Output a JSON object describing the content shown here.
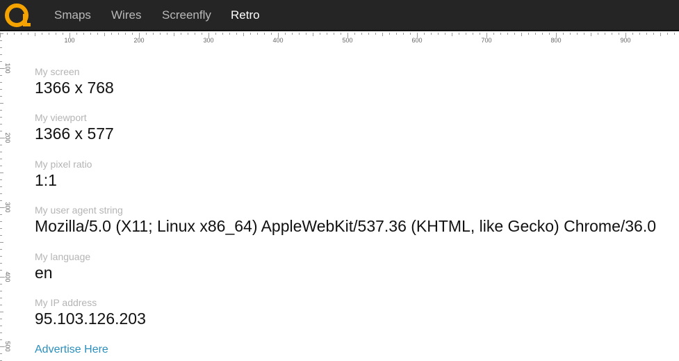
{
  "nav": {
    "logo_icon": "retro-a-logo-icon",
    "items": [
      {
        "label": "Smaps",
        "active": false
      },
      {
        "label": "Wires",
        "active": false
      },
      {
        "label": "Screenfly",
        "active": false
      },
      {
        "label": "Retro",
        "active": true
      }
    ]
  },
  "ruler": {
    "top_labels": [
      "100",
      "200",
      "300",
      "400",
      "500",
      "600",
      "700",
      "800",
      "900"
    ],
    "left_labels": [
      "100",
      "200",
      "300",
      "400",
      "500"
    ]
  },
  "info": {
    "screen": {
      "label": "My screen",
      "value": "1366 x 768"
    },
    "viewport": {
      "label": "My viewport",
      "value": "1366 x 577"
    },
    "pixel_ratio": {
      "label": "My pixel ratio",
      "value": "1:1"
    },
    "user_agent": {
      "label": "My user agent string",
      "value": "Mozilla/5.0 (X11; Linux x86_64) AppleWebKit/537.36 (KHTML, like Gecko) Chrome/36.0"
    },
    "language": {
      "label": "My language",
      "value": "en"
    },
    "ip": {
      "label": "My IP address",
      "value": "95.103.126.203"
    }
  },
  "advertise": {
    "label": "Advertise Here"
  },
  "colors": {
    "topbar": "#252525",
    "logo_orange": "#f5a300",
    "link": "#2a8fbd",
    "label_gray": "#b4b4b4"
  }
}
